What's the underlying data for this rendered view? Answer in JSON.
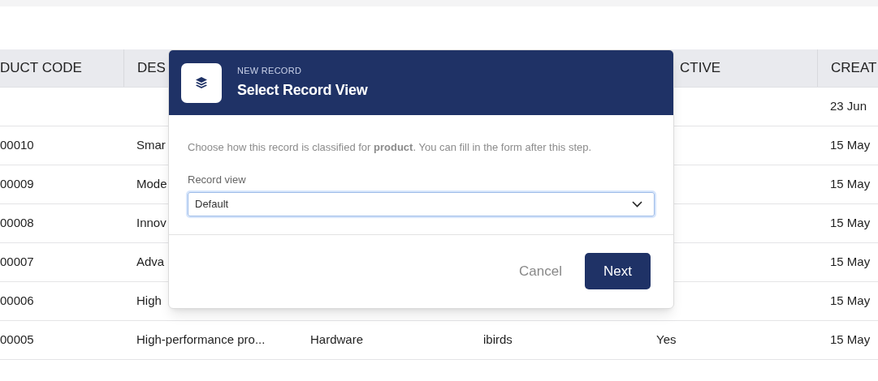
{
  "table": {
    "columns": {
      "code": "DUCT CODE",
      "description": "DES",
      "active": "CTIVE",
      "created": "CREAT"
    },
    "rows": [
      {
        "created": "23 Jun"
      },
      {
        "code": "00010",
        "description": "Smar",
        "created": "15 May"
      },
      {
        "code": "00009",
        "description": "Mode",
        "created": "15 May"
      },
      {
        "code": "00008",
        "description": "Innov",
        "created": "15 May"
      },
      {
        "code": "00007",
        "description": "Adva",
        "created": "15 May"
      },
      {
        "code": "00006",
        "description": "High",
        "created": "15 May"
      },
      {
        "code": "00005",
        "description": "High-performance pro...",
        "category": "Hardware",
        "column_4": "ibirds",
        "active": "Yes",
        "created": "15 May"
      }
    ]
  },
  "dialog": {
    "eyebrow": "NEW RECORD",
    "title": "Select Record View",
    "description": "Choose how this record is classified for **product**. You can fill in the form after this step.",
    "field": {
      "label": "Record view",
      "value": "Default"
    },
    "buttons": [
      {
        "kind": "secondary",
        "label": "Cancel"
      },
      {
        "kind": "primary",
        "label": "Next"
      }
    ]
  }
}
